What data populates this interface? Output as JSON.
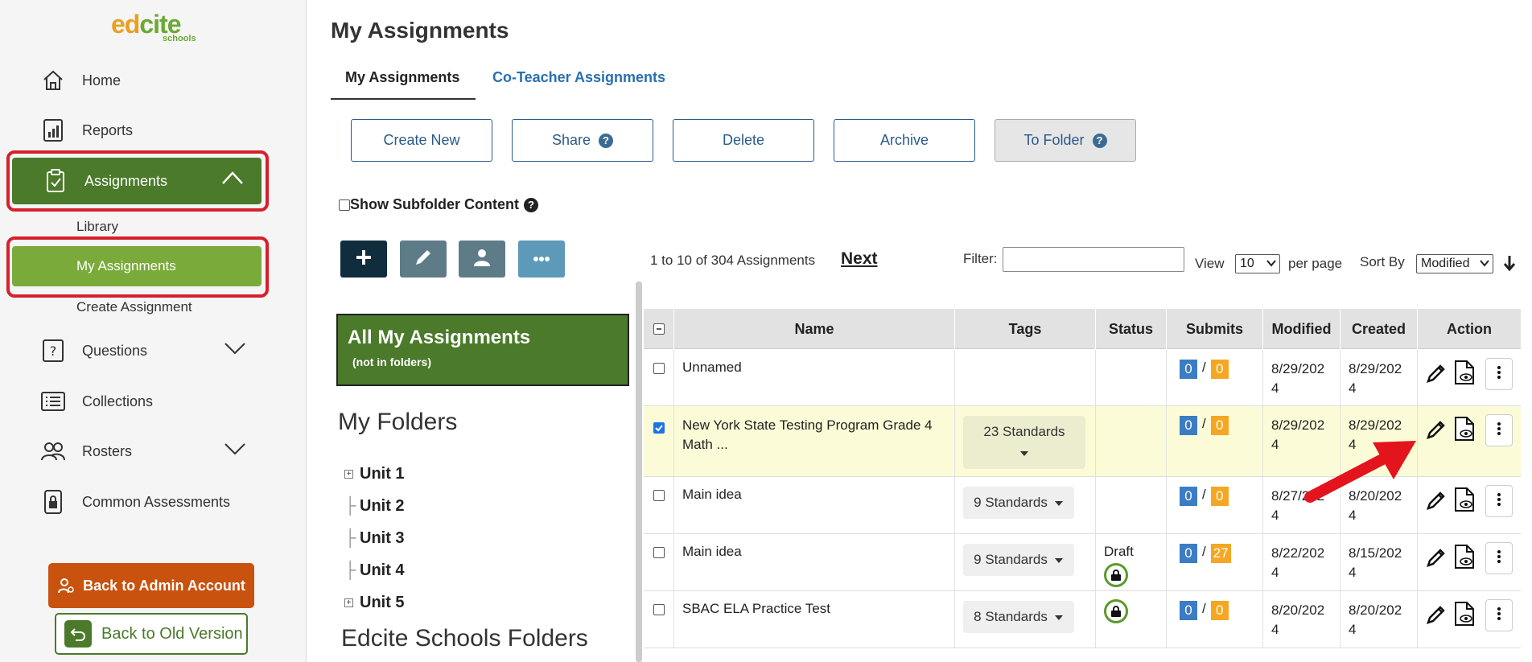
{
  "brand": {
    "logo_main_a": "ed",
    "logo_main_b": "cite",
    "logo_sub": "schools"
  },
  "sidebar": {
    "items": [
      {
        "label": "Home"
      },
      {
        "label": "Reports"
      },
      {
        "label": "Assignments"
      },
      {
        "label": "Questions"
      },
      {
        "label": "Collections"
      },
      {
        "label": "Rosters"
      },
      {
        "label": "Common Assessments"
      }
    ],
    "sub_items": [
      "Library",
      "My Assignments",
      "Create Assignment"
    ],
    "back_admin": "Back to Admin Account",
    "back_old": "Back to Old Version"
  },
  "page": {
    "title": "My Assignments"
  },
  "tabs": [
    {
      "label": "My Assignments"
    },
    {
      "label": "Co-Teacher Assignments"
    }
  ],
  "toolbar": {
    "create": "Create New",
    "share": "Share",
    "delete": "Delete",
    "archive": "Archive",
    "to_folder": "To Folder",
    "help": "?"
  },
  "subfolder": {
    "label": "Show Subfolder Content"
  },
  "folders": {
    "all_title": "All My Assignments",
    "all_sub": "(not in folders)",
    "my_title": "My Folders",
    "units": [
      "Unit 1",
      "Unit 2",
      "Unit 3",
      "Unit 4",
      "Unit 5"
    ],
    "edcite_title": "Edcite Schools Folders"
  },
  "pager": {
    "range": "1 to 10 of 304 Assignments",
    "next": "Next",
    "filter_label": "Filter:",
    "view_label": "View",
    "per_page_value": "10",
    "per_page_label": "per page",
    "sort_label": "Sort By",
    "sort_value": "Modified"
  },
  "table": {
    "headers": [
      "Name",
      "Tags",
      "Status",
      "Submits",
      "Modified",
      "Created",
      "Action"
    ],
    "rows": [
      {
        "name": "Unnamed",
        "tags": "",
        "status": "",
        "sub_a": "0",
        "sub_b": "0",
        "modified": "8/29/202 4",
        "created": "8/29/202 4"
      },
      {
        "name": "New York State Testing Program Grade 4 Math ...",
        "tags": "23 Standards",
        "status": "",
        "sub_a": "0",
        "sub_b": "0",
        "modified": "8/29/202 4",
        "created": "8/29/202 4"
      },
      {
        "name": "Main idea",
        "tags": "9 Standards",
        "status": "",
        "sub_a": "0",
        "sub_b": "0",
        "modified": "8/27/202 4",
        "created": "8/20/202 4"
      },
      {
        "name": "Main idea",
        "tags": "9 Standards",
        "status": "Draft",
        "sub_a": "0",
        "sub_b": "27",
        "modified": "8/22/202 4",
        "created": "8/15/202 4"
      },
      {
        "name": "SBAC ELA Practice Test",
        "tags": "8 Standards",
        "status": "",
        "sub_a": "0",
        "sub_b": "0",
        "modified": "8/20/202 4",
        "created": "8/20/202 4"
      }
    ],
    "slash": "/"
  },
  "colors": {
    "green_dark": "#4a7a2a",
    "green_light": "#7aab3a",
    "orange": "#c9520e",
    "red": "#d7202a",
    "blue": "#2a6fb0"
  }
}
